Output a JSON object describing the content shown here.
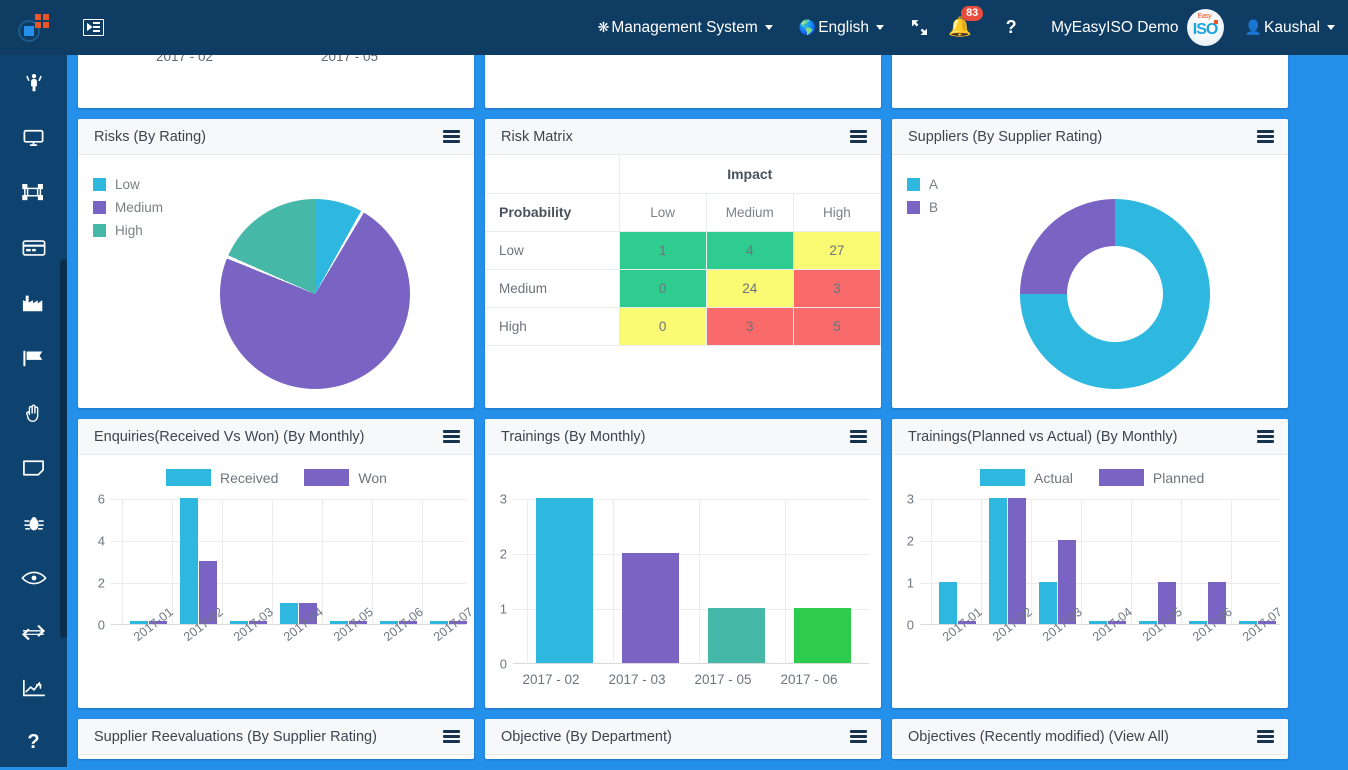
{
  "navbar": {
    "logo_name": "app-logo",
    "toggle_name": "sidebar-toggle",
    "management_system": "Management System",
    "management_icon": "gear-icon",
    "language": "English",
    "language_icon": "globe-icon",
    "expand_icon": "expand-arrows-icon",
    "bell_icon": "bell-icon",
    "notification_count": "83",
    "help_label": "?",
    "brand": "MyEasyISO Demo",
    "brand_logo_text": "ISO",
    "brand_logo_spark": "Easy",
    "user": "Kaushal",
    "user_icon": "user-icon",
    "colors": {
      "bar": "#0e3c63",
      "badge": "#e74c3c"
    }
  },
  "sidebar": {
    "items": [
      {
        "icon": "person-raised-hands-icon",
        "name": "sidebar-item-people"
      },
      {
        "icon": "monitor-icon",
        "name": "sidebar-item-monitor"
      },
      {
        "icon": "process-nodes-icon",
        "name": "sidebar-item-process"
      },
      {
        "icon": "card-icon",
        "name": "sidebar-item-card"
      },
      {
        "icon": "factory-icon",
        "name": "sidebar-item-factory"
      },
      {
        "icon": "flag-icon",
        "name": "sidebar-item-flag"
      },
      {
        "icon": "hand-icon",
        "name": "sidebar-item-hand"
      },
      {
        "icon": "note-icon",
        "name": "sidebar-item-note"
      },
      {
        "icon": "bug-icon",
        "name": "sidebar-item-bug"
      },
      {
        "icon": "eye-icon",
        "name": "sidebar-item-eye"
      },
      {
        "icon": "exchange-icon",
        "name": "sidebar-item-exchange"
      },
      {
        "icon": "trend-chart-icon",
        "name": "sidebar-item-reports"
      },
      {
        "icon": "question-mark-icon",
        "name": "sidebar-item-help"
      }
    ],
    "background": "#0e4370"
  },
  "page": {
    "background": "#2490ea"
  },
  "partial_top": {
    "card1_labels": [
      "2017 - 02",
      "2017 - 05"
    ]
  },
  "cards": {
    "risks": {
      "title": "Risks (By Rating)",
      "menu": "chart-menu-icon"
    },
    "risk_matrix": {
      "title": "Risk Matrix",
      "menu": "chart-menu-icon"
    },
    "suppliers": {
      "title": "Suppliers (By Supplier Rating)",
      "menu": "chart-menu-icon"
    },
    "enquiries": {
      "title": "Enquiries(Received Vs Won) (By Monthly)",
      "menu": "chart-menu-icon"
    },
    "trainings": {
      "title": "Trainings (By Monthly)",
      "menu": "chart-menu-icon"
    },
    "trainings_pva": {
      "title": "Trainings(Planned vs Actual) (By Monthly)",
      "menu": "chart-menu-icon"
    },
    "supplier_reevals": {
      "title": "Supplier Reevaluations (By Supplier Rating)",
      "menu": "chart-menu-icon"
    },
    "objective_dept": {
      "title": "Objective (By Department)",
      "menu": "chart-menu-icon"
    },
    "objectives_recent": {
      "title": "Objectives (Recently modified) (View All)",
      "menu": "chart-menu-icon"
    }
  },
  "risk_matrix": {
    "impact_header": "Impact",
    "probability_header": "Probability",
    "impact_levels": [
      "Low",
      "Medium",
      "High"
    ],
    "probability_levels": [
      "Low",
      "Medium",
      "High"
    ],
    "cells": [
      [
        {
          "value": "1",
          "level": "g"
        },
        {
          "value": "4",
          "level": "g"
        },
        {
          "value": "27",
          "level": "y"
        }
      ],
      [
        {
          "value": "0",
          "level": "g"
        },
        {
          "value": "24",
          "level": "y"
        },
        {
          "value": "3",
          "level": "r"
        }
      ],
      [
        {
          "value": "0",
          "level": "y"
        },
        {
          "value": "3",
          "level": "r"
        },
        {
          "value": "5",
          "level": "r"
        }
      ]
    ],
    "colors": {
      "green": "#2ecc8f",
      "yellow": "#fafa73",
      "red": "#f96a6a"
    }
  },
  "chart_data": [
    {
      "id": "risks-by-rating",
      "type": "pie",
      "title": "Risks (By Rating)",
      "categories": [
        "Low",
        "Medium",
        "High"
      ],
      "values": [
        8,
        73,
        19
      ],
      "colors": [
        "#2eb8e0",
        "#7964c4",
        "#45b8a8"
      ],
      "legend_position": "left"
    },
    {
      "id": "suppliers-by-supplier-rating",
      "type": "pie",
      "title": "Suppliers (By Supplier Rating)",
      "categories": [
        "A",
        "B"
      ],
      "values": [
        75,
        25
      ],
      "colors": [
        "#2eb8e0",
        "#7964c4"
      ],
      "legend_position": "left"
    },
    {
      "id": "enquiries-received-vs-won",
      "type": "bar",
      "title": "Enquiries(Received Vs Won) (By Monthly)",
      "categories": [
        "2017-01",
        "2017-02",
        "2017-03",
        "2017-04",
        "2017-05",
        "2017-06",
        "2017-07"
      ],
      "series": [
        {
          "name": "Received",
          "values": [
            0,
            6,
            0,
            1,
            0,
            0,
            0
          ],
          "color": "#2eb8e0"
        },
        {
          "name": "Won",
          "values": [
            0,
            3,
            0,
            1,
            0,
            0,
            0
          ],
          "color": "#7964c4"
        }
      ],
      "yticks": [
        0,
        2,
        4,
        6
      ],
      "ylim": [
        0,
        6
      ],
      "xlabel": "",
      "ylabel": "",
      "grid": true,
      "legend_position": "top"
    },
    {
      "id": "trainings-by-monthly",
      "type": "bar",
      "title": "Trainings (By Monthly)",
      "categories": [
        "2017 - 02",
        "2017 - 03",
        "2017 - 05",
        "2017 - 06"
      ],
      "values": [
        3,
        2,
        1,
        1
      ],
      "colors": [
        "#2eb8e0",
        "#7964c4",
        "#45b8a8",
        "#2ecc4e"
      ],
      "yticks": [
        0,
        1,
        2,
        3
      ],
      "ylim": [
        0,
        3
      ],
      "xlabel": "",
      "ylabel": "",
      "grid": true,
      "legend_position": "none"
    },
    {
      "id": "trainings-planned-vs-actual",
      "type": "bar",
      "title": "Trainings(Planned vs Actual) (By Monthly)",
      "categories": [
        "2017-01",
        "2017-02",
        "2017-03",
        "2017-04",
        "2017-05",
        "2017-06",
        "2017-07"
      ],
      "series": [
        {
          "name": "Actual",
          "values": [
            1,
            3,
            1,
            0,
            0,
            0,
            0
          ],
          "color": "#2eb8e0"
        },
        {
          "name": "Planned",
          "values": [
            0,
            3,
            2,
            0,
            1,
            1,
            0
          ],
          "color": "#7964c4"
        }
      ],
      "yticks": [
        0,
        1,
        2,
        3
      ],
      "ylim": [
        0,
        3
      ],
      "xlabel": "",
      "ylabel": "",
      "grid": true,
      "legend_position": "top"
    }
  ]
}
